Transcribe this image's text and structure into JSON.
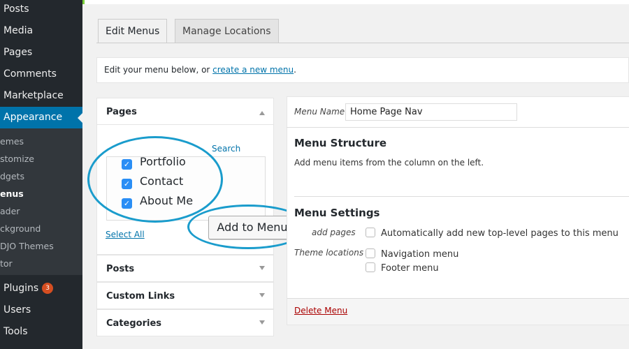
{
  "sidebar": {
    "items_top": [
      "Posts",
      "Media",
      "Pages",
      "Comments",
      "Marketplace",
      "Appearance"
    ],
    "submenu": [
      "emes",
      "stomize",
      "dgets",
      "enus",
      "ader",
      "ckground",
      "DJO Themes",
      "tor"
    ],
    "items_bottom": [
      "Plugins",
      "Users",
      "Tools"
    ],
    "plugins_badge": "3"
  },
  "tabs": {
    "edit": "Edit Menus",
    "manage": "Manage Locations"
  },
  "notice": {
    "text": "Edit your menu below, or ",
    "link": "create a new menu",
    "end": "."
  },
  "left": {
    "pages_title": "Pages",
    "search": "Search",
    "pages": [
      "Portfolio",
      "Contact",
      "About Me"
    ],
    "select_all": "Select All",
    "add_button": "Add to Menu",
    "sections": [
      "Posts",
      "Custom Links",
      "Categories"
    ]
  },
  "right": {
    "menu_name_label": "Menu Name",
    "menu_name_value": "Home Page Nav",
    "structure_title": "Menu Structure",
    "structure_hint": "Add menu items from the column on the left.",
    "settings_title": "Menu Settings",
    "auto_label": "add pages",
    "auto_option": "Automatically add new top-level pages to this menu",
    "locations_label": "Theme locations",
    "locations": [
      "Navigation menu",
      "Footer menu"
    ],
    "delete": "Delete Menu"
  },
  "colors": {
    "accent": "#0073aa",
    "highlight_ring": "#1a9ccc",
    "delete": "#a00"
  }
}
